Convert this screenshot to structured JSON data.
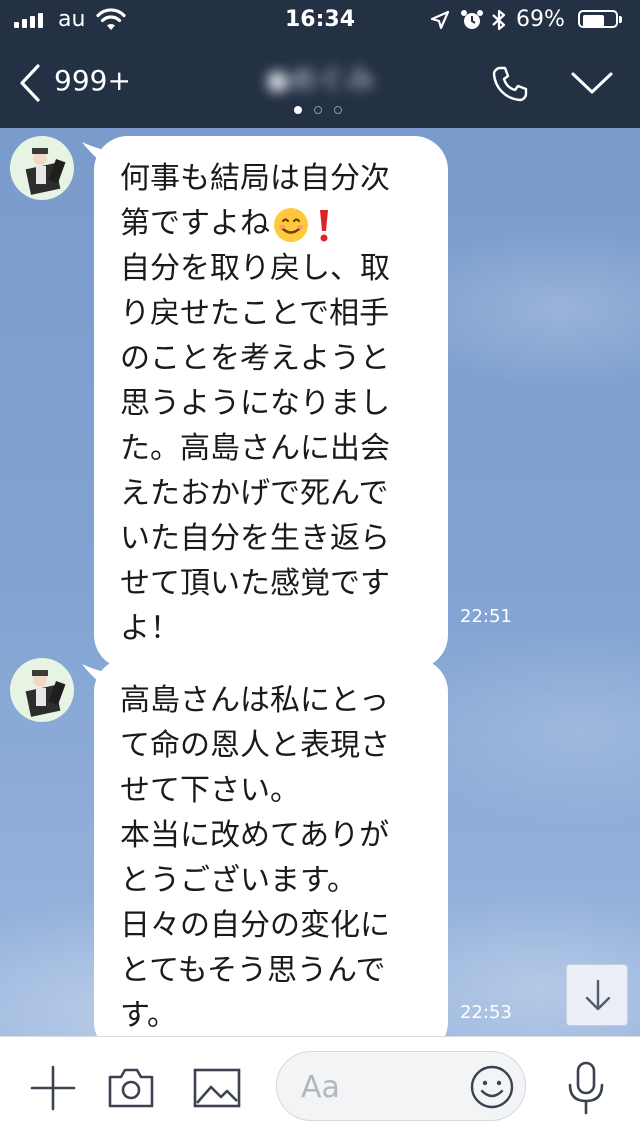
{
  "status_bar": {
    "carrier": "au",
    "time": "16:34",
    "battery_percent": "69%",
    "battery_level": 0.69,
    "signal_bars": 4,
    "icons": [
      "signal-icon",
      "wifi-icon",
      "location-arrow-icon",
      "alarm-icon",
      "bluetooth-icon",
      "battery-icon"
    ]
  },
  "header": {
    "back_label": "999+",
    "contact_name": "●めぐみ",
    "page_dots": 3,
    "active_page": 1,
    "icons": [
      "back-chevron-icon",
      "phone-icon",
      "chevron-down-icon"
    ]
  },
  "messages": [
    {
      "sender": "contact",
      "lines": [
        "何事も結局は自分次",
        "第ですよね",
        "自分を取り戻し、取",
        "り戻せたことで相手",
        "のことを考えようと",
        "思うようになりまし",
        "た。高島さんに出会",
        "えたおかげで死んで",
        "いた自分を生き返ら",
        "せて頂いた感覚です",
        "よ！"
      ],
      "emoji_after_line_2": [
        "smiling-face-emoji",
        "red-exclamation-emoji"
      ],
      "time": "22:51"
    },
    {
      "sender": "contact",
      "lines": [
        "高島さんは私にとっ",
        "て命の恩人と表現さ",
        "せて下さい。",
        "本当に改めてありが",
        "とうございます。",
        "日々の自分の変化に",
        "とてもそう思うんで",
        "す。"
      ],
      "time": "22:53"
    }
  ],
  "input_bar": {
    "placeholder": "Aa",
    "icons": [
      "plus-icon",
      "camera-icon",
      "image-icon",
      "emoji-icon",
      "microphone-icon"
    ]
  },
  "colors": {
    "header_bg": "#243044",
    "chat_bg": "#7f9fcf",
    "bubble_bg": "#ffffff",
    "timestamp": "#ffffff"
  }
}
